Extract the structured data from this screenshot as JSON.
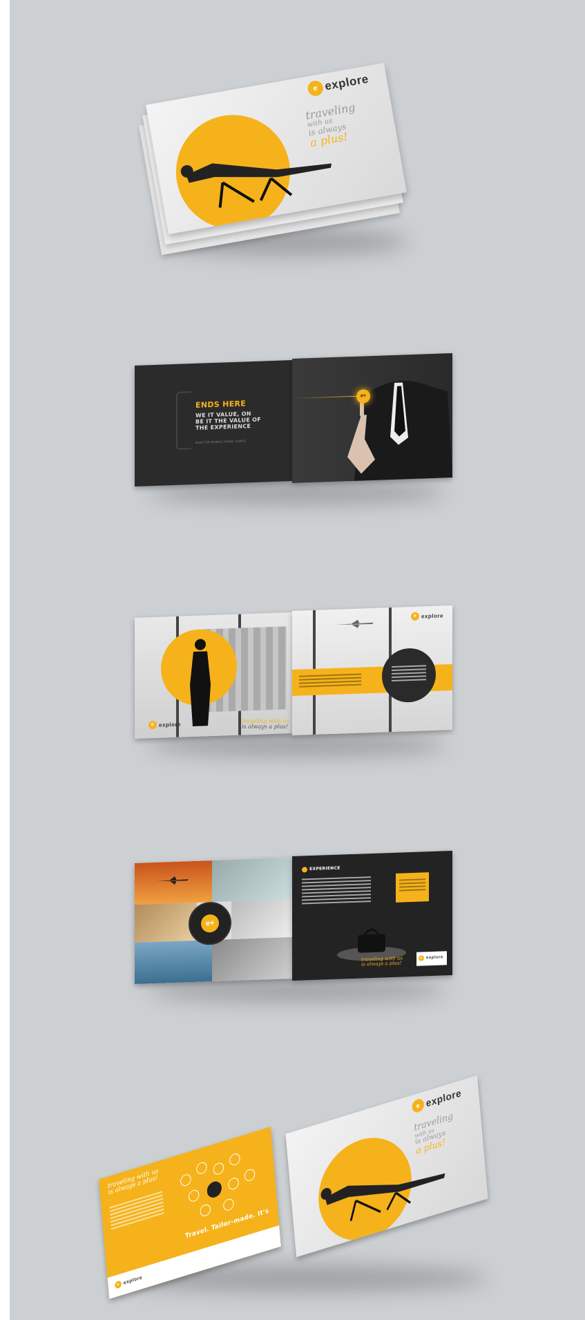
{
  "brand": {
    "logo_text": "explore",
    "accent": "#f5b21b",
    "background": "#cdd0d3",
    "dark_page": "#2a2a2a"
  },
  "mockup1": {
    "tagline_line1": "traveling",
    "tagline_line2": "with us",
    "tagline_line3": "is always",
    "tagline_line4": "a plus!"
  },
  "mockup2": {
    "headline": "ENDS HERE",
    "body_line1": "WE IT VALUE, ON",
    "body_line2": "BE IT THE VALUE OF",
    "body_line3": "THE EXPERIENCE",
    "footer": "MAKE THE PERFECT TRAVEL CHOICE",
    "badge_text": "e+"
  },
  "mockup3": {
    "tagline_line1": "traveling with us",
    "tagline_line2": "is always a plus!"
  },
  "mockup4": {
    "badge_text": "e+",
    "section_title": "EXPERIENCE",
    "tagline_line1": "traveling with us",
    "tagline_line2": "is always a plus!"
  },
  "mockup5": {
    "back_title_line1": "traveling with us",
    "back_title_line2": "is always a plus!",
    "back_slogan": "Travel. Tailor-made. It's",
    "tagline_line1": "traveling",
    "tagline_line2": "with us",
    "tagline_line3": "is always",
    "tagline_line4": "a plus!"
  }
}
